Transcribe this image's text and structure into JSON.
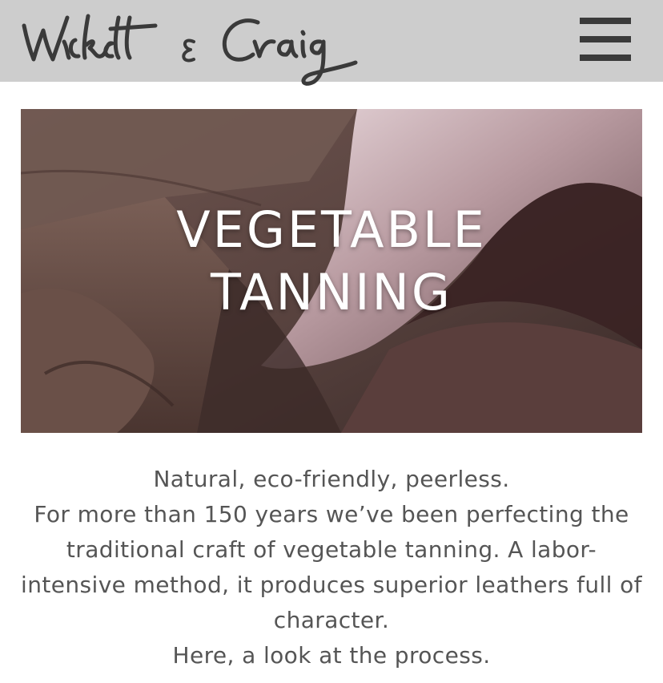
{
  "header": {
    "logo_text": "Wickett & Craig",
    "menu_icon": "hamburger-menu-icon",
    "background_color": "#cdcdcd"
  },
  "hero": {
    "title_line1": "VEGETABLE",
    "title_line2": "TANNING",
    "image": "leather-hides-photo"
  },
  "intro": {
    "tagline": "Natural, eco-friendly, peerless.",
    "paragraph": "For more than 150 years we’ve been perfecting the traditional craft of vegetable tanning. A labor-intensive method, it produces superior leathers full of character.",
    "closing": "Here, a look at the process."
  },
  "colors": {
    "text": "#555555",
    "menu_icon": "#3a3a3a"
  }
}
